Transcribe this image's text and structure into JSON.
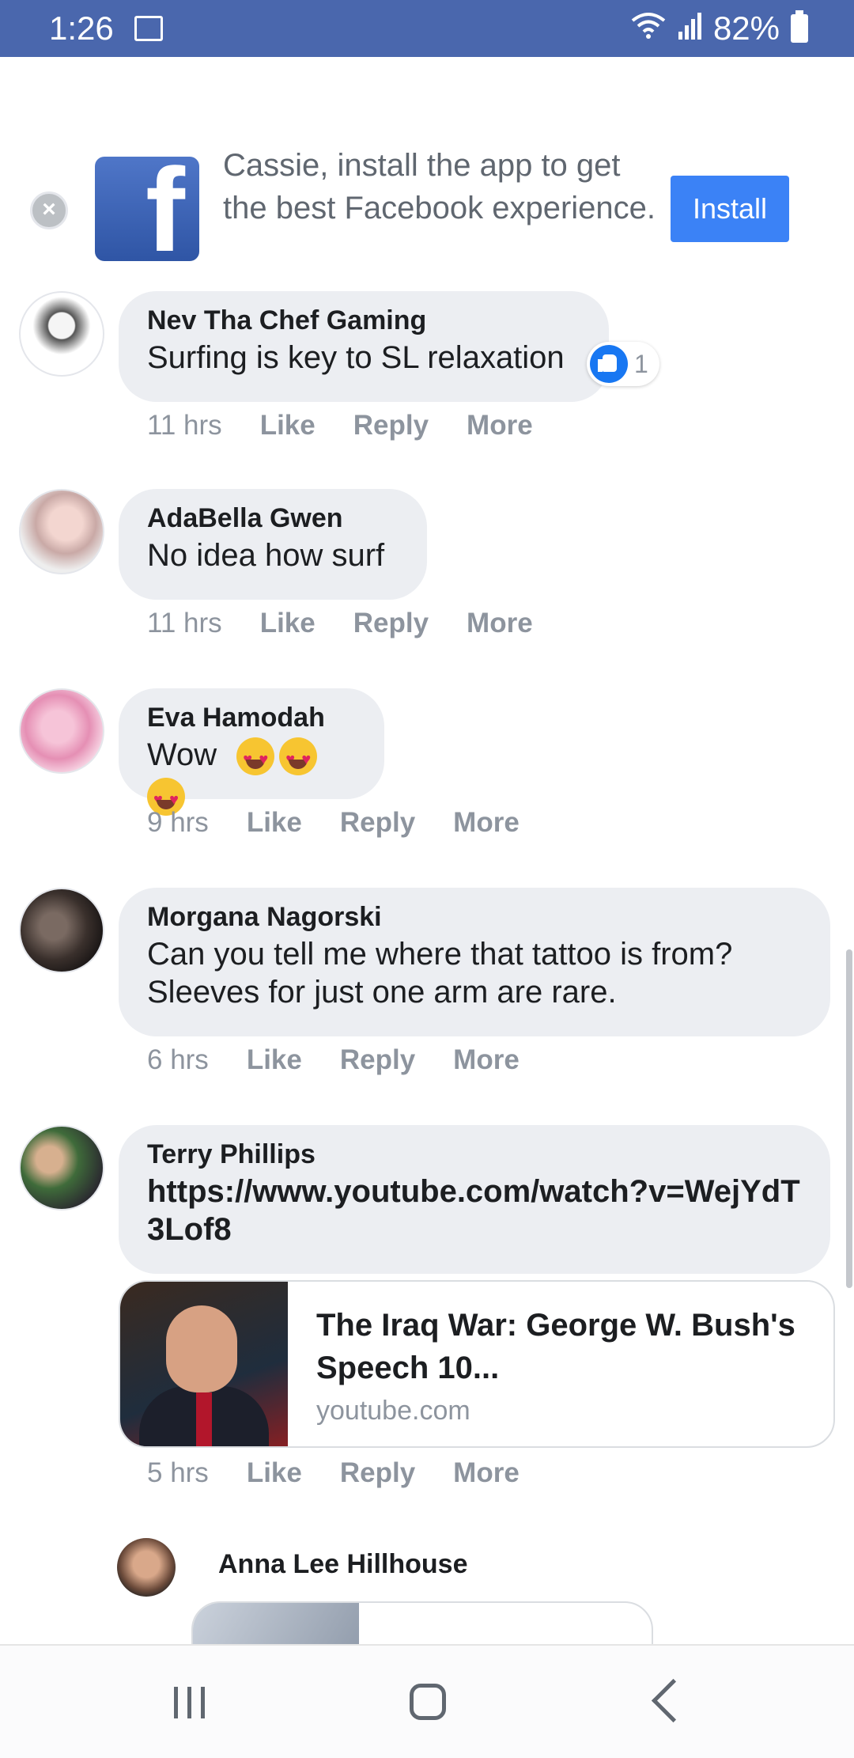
{
  "status_bar": {
    "time": "1:26",
    "battery": "82%",
    "icons": [
      "gallery-icon",
      "wifi-icon",
      "signal-icon",
      "battery-icon"
    ]
  },
  "install_banner": {
    "message": "Cassie, install the app to get the best Facebook experience.",
    "install_label": "Install",
    "logo_letter": "f"
  },
  "comments": [
    {
      "author": "Nev Tha Chef Gaming",
      "text": "Surfing is key to SL relaxation",
      "time": "11 hrs",
      "reactions_count": "1"
    },
    {
      "author": "AdaBella Gwen",
      "text": "No idea how surf",
      "time": "11 hrs"
    },
    {
      "author": "Eva Hamodah",
      "text": "Wow",
      "time": "9 hrs"
    },
    {
      "author": "Morgana Nagorski",
      "text": "Can you tell me where that tattoo is from? Sleeves for just one arm are rare.",
      "time": "6 hrs"
    },
    {
      "author": "Terry Phillips",
      "text": "https://www.youtube.com/watch?v=WejYdT3Lof8",
      "time": "5 hrs",
      "link_preview": {
        "title": "The Iraq War: George W. Bush's Speech 10...",
        "domain": "youtube.com"
      }
    }
  ],
  "actions": {
    "like": "Like",
    "reply": "Reply",
    "more": "More"
  },
  "nested_comment": {
    "author": "Anna Lee Hillhouse"
  },
  "colors": {
    "status_bar": "#4a67ad",
    "install_button": "#3b82f6",
    "bubble": "#eceef2",
    "meta_text": "#8d949e"
  }
}
